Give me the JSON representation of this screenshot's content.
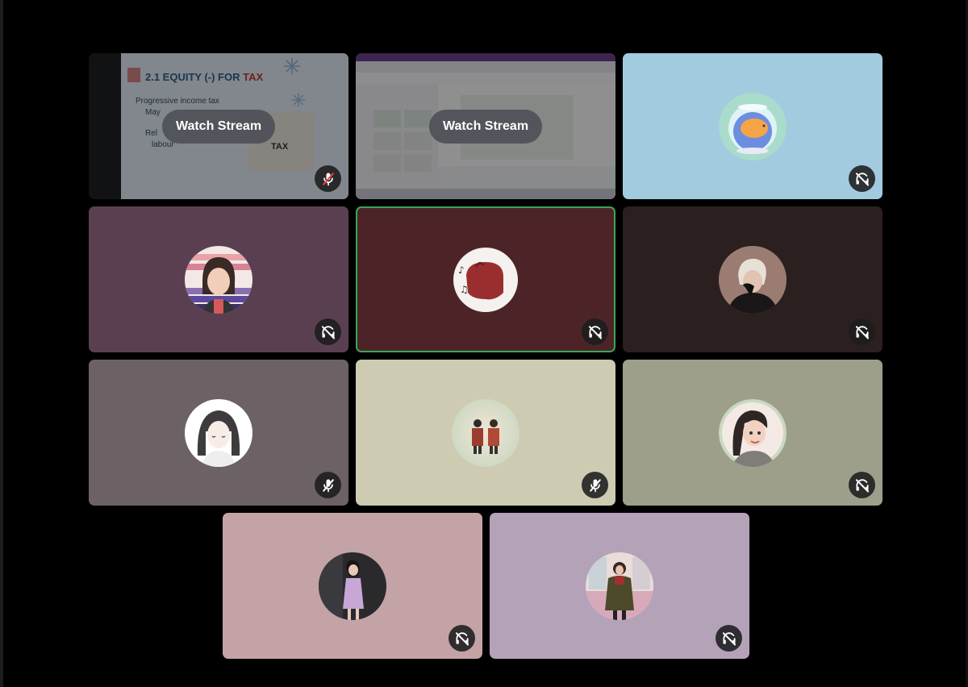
{
  "call": {
    "stream_button_label": "Watch Stream"
  },
  "screenshare_1": {
    "slide_title": "2.1 EQUITY (-) FOR",
    "slide_title_red": "TAX",
    "bullet_1": "Progressive income tax",
    "bullet_2": "May",
    "bullet_3": "Rel",
    "bullet_4": "labour",
    "bag_label": "TAX"
  },
  "participants": [
    {
      "id": "screenshare-1",
      "kind": "stream",
      "bg": "#1e1f22",
      "status": "muted"
    },
    {
      "id": "screenshare-2",
      "kind": "stream",
      "bg": "#2a2433"
    },
    {
      "id": "fishbowl",
      "kind": "avatar",
      "bg": "#a3cbe0",
      "status": "deafened"
    },
    {
      "id": "girl-glasses",
      "kind": "avatar",
      "bg": "#5a3f51",
      "status": "deafened"
    },
    {
      "id": "red-mascot",
      "kind": "avatar",
      "bg": "#4c2427",
      "status": "deafened",
      "speaking": true
    },
    {
      "id": "boy-dark",
      "kind": "avatar",
      "bg": "#2b201f",
      "status": "deafened"
    },
    {
      "id": "anime-girl",
      "kind": "avatar",
      "bg": "#6c6266",
      "status": "muted"
    },
    {
      "id": "two-men",
      "kind": "avatar",
      "bg": "#cdcbb1",
      "status": "muted"
    },
    {
      "id": "smiling-girl",
      "kind": "avatar",
      "bg": "#9e9f8b",
      "status": "deafened"
    },
    {
      "id": "woman-dress",
      "kind": "avatar",
      "bg": "#c4a3a7",
      "status": "deafened"
    },
    {
      "id": "woman-street",
      "kind": "avatar",
      "bg": "#b4a3b8",
      "status": "deafened"
    }
  ],
  "colors": {
    "speaking_ring": "#3ba55c",
    "icon_bg": "#1c1c1e",
    "icon_fg": "#ffffff",
    "muted_slash": "#ed4245"
  },
  "icons": {
    "muted": "mic-off-icon",
    "deafened": "headphones-off-icon"
  }
}
